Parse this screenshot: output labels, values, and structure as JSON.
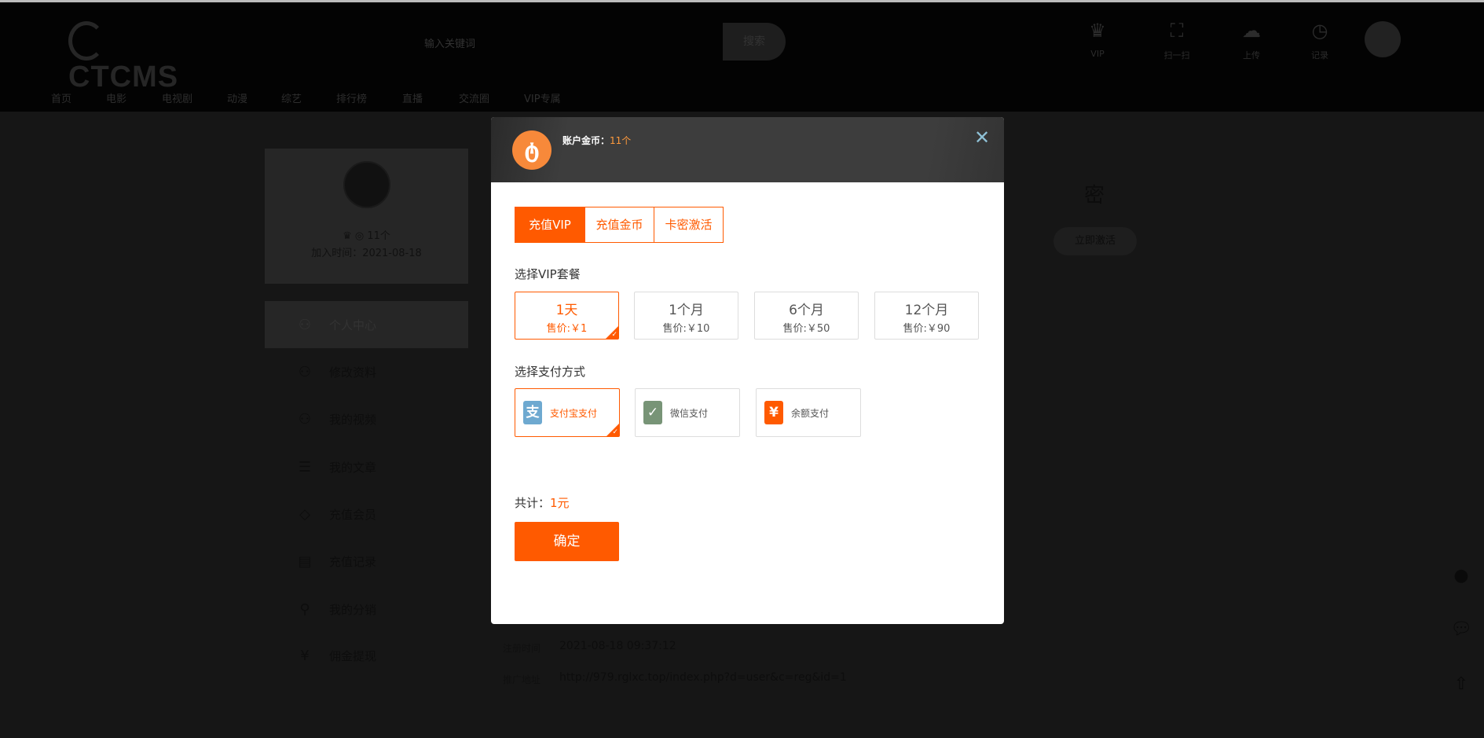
{
  "header": {
    "logo": "CTCMS",
    "search_placeholder": "输入关键词",
    "search_button": "搜索",
    "icons": [
      {
        "label": "VIP",
        "icon": "crown-icon"
      },
      {
        "label": "扫一扫",
        "icon": "scan-icon"
      },
      {
        "label": "上传",
        "icon": "upload-icon"
      },
      {
        "label": "记录",
        "icon": "history-icon"
      }
    ]
  },
  "nav": [
    "首页",
    "电影",
    "电视剧",
    "动漫",
    "综艺",
    "排行榜",
    "直播",
    "交流圈",
    "VIP专属"
  ],
  "profile": {
    "coins": "11个",
    "join_date": "加入时间：2021-08-18"
  },
  "menu": [
    "个人中心",
    "修改资料",
    "我的视频",
    "我的文章",
    "充值会员",
    "充值记录",
    "我的分销",
    "佣金提现"
  ],
  "right": {
    "title": "密",
    "activate": "立即激活"
  },
  "info": [
    {
      "label": "注册时间",
      "value": "2021-08-18 09:37:12"
    },
    {
      "label": "推广地址",
      "value": "http://979.rglxc.top/index.php?d=user&c=reg&id=1"
    }
  ],
  "modal": {
    "coins_label": "账户金币：",
    "coins_value": "11个",
    "tabs": [
      "充值VIP",
      "充值金币",
      "卡密激活"
    ],
    "pkg_title": "选择VIP套餐",
    "packages": [
      {
        "name": "1天",
        "price": "售价:￥1"
      },
      {
        "name": "1个月",
        "price": "售价:￥10"
      },
      {
        "name": "6个月",
        "price": "售价:￥50"
      },
      {
        "name": "12个月",
        "price": "售价:￥90"
      }
    ],
    "pay_title": "选择支付方式",
    "payments": [
      "支付宝支付",
      "微信支付",
      "余额支付"
    ],
    "total_label": "共计：",
    "total_value": "1元",
    "confirm": "确定"
  },
  "colors": {
    "accent": "#ff5a00",
    "alipay": "#6ea9d0",
    "wechat": "#789477",
    "balance": "#ff5a00"
  }
}
